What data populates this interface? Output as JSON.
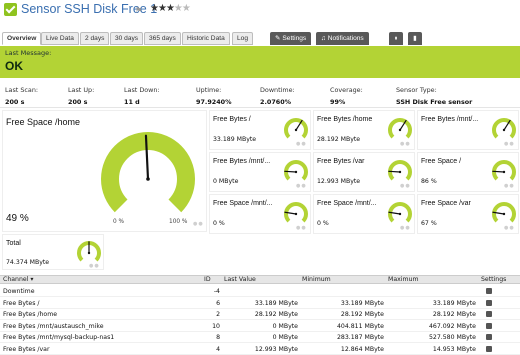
{
  "header": {
    "title": "Sensor SSH Disk Free 1",
    "flag_icon": "flag-icon",
    "rating": 3,
    "rating_max": 5,
    "status_color": "#8fc31f"
  },
  "tabs": [
    {
      "label": "Overview",
      "active": true
    },
    {
      "label": "Live Data"
    },
    {
      "label": "2 days"
    },
    {
      "label": "30 days"
    },
    {
      "label": "365 days"
    },
    {
      "label": "Historic Data"
    },
    {
      "label": "Log"
    },
    {
      "label": "Settings",
      "icon": "wrench-icon"
    },
    {
      "label": "Notifications",
      "icon": "bell-icon"
    },
    {
      "label": "",
      "icon": "pause-icon"
    },
    {
      "label": "",
      "icon": "delete-icon"
    }
  ],
  "status": {
    "label": "Last Message:",
    "value": "OK",
    "color": "#b3d335"
  },
  "stats": [
    {
      "key": "Last Scan:",
      "value": "200 s"
    },
    {
      "key": "Last Up:",
      "value": "200 s"
    },
    {
      "key": "Last Down:",
      "value": "11 d"
    },
    {
      "key": "Uptime:",
      "value": "97.9240%"
    },
    {
      "key": "Downtime:",
      "value": "2.0760%"
    },
    {
      "key": "Coverage:",
      "value": "99%"
    },
    {
      "key": "Sensor Type:",
      "value": "SSH Disk Free sensor"
    }
  ],
  "big_gauge": {
    "label": "Free Space /home",
    "value": "49 %",
    "level": 0.49,
    "scale_min": "0 %",
    "scale_max": "100 %",
    "color": "#b3d335"
  },
  "gauges": [
    {
      "label": "Free Bytes /",
      "value": "33.189 MByte",
      "level": 0.62
    },
    {
      "label": "Free Bytes /home",
      "value": "28.192 MByte",
      "level": 0.62
    },
    {
      "label": "Free Bytes /mnt/...",
      "value": "",
      "level": 0.62
    },
    {
      "label": "Free Bytes /mnt/...",
      "value": "0 MByte",
      "level": 0.18
    },
    {
      "label": "Free Bytes /var",
      "value": "12.993 MByte",
      "level": 0.18
    },
    {
      "label": "Free Space /",
      "value": "86 %",
      "level": 0.18
    },
    {
      "label": "Free Space /mnt/...",
      "value": "0 %",
      "level": 0.2
    },
    {
      "label": "Free Space /mnt/...",
      "value": "0 %",
      "level": 0.2
    },
    {
      "label": "Free Space /var",
      "value": "67 %",
      "level": 0.2
    }
  ],
  "total": {
    "label": "Total",
    "value": "74.374 MByte",
    "level": 0.5
  },
  "table": {
    "headers": [
      "Channel",
      "ID",
      "Last Value",
      "Minimum",
      "Maximum",
      "Settings"
    ],
    "rows": [
      {
        "channel": "Downtime",
        "id": "-4",
        "last": "",
        "min": "",
        "max": ""
      },
      {
        "channel": "Free Bytes /",
        "id": "6",
        "last": "33.189 MByte",
        "min": "33.189 MByte",
        "max": "33.189 MByte"
      },
      {
        "channel": "Free Bytes /home",
        "id": "2",
        "last": "28.192 MByte",
        "min": "28.192 MByte",
        "max": "28.192 MByte"
      },
      {
        "channel": "Free Bytes /mnt/austausch_mike",
        "id": "10",
        "last": "0 MByte",
        "min": "404.811 MByte",
        "max": "467.092 MByte"
      },
      {
        "channel": "Free Bytes /mnt/mysql-backup-nas1",
        "id": "8",
        "last": "0 MByte",
        "min": "283.187 MByte",
        "max": "527.580 MByte"
      },
      {
        "channel": "Free Bytes /var",
        "id": "4",
        "last": "12.993 MByte",
        "min": "12.864 MByte",
        "max": "14.953 MByte"
      }
    ]
  }
}
